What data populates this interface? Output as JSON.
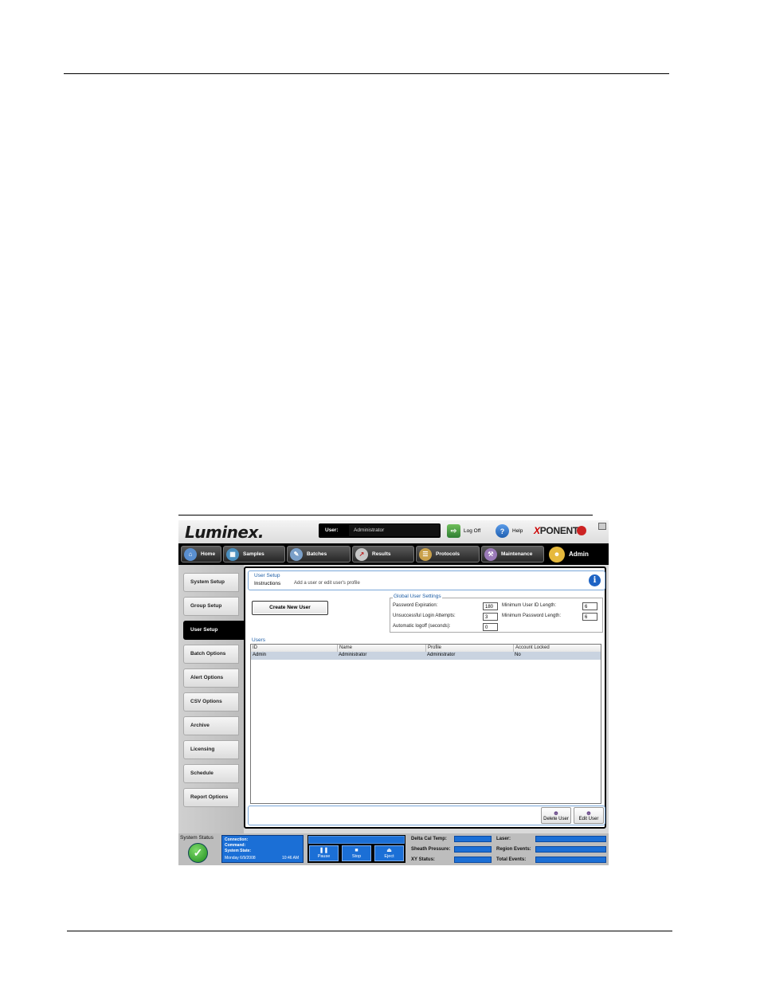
{
  "app": {
    "logo": "Luminex.",
    "user_label": "User:",
    "user_value": "Administrator",
    "logoff_label": "Log Off",
    "help_label": "Help",
    "brand": {
      "x": "X",
      "rest": "PONENT"
    }
  },
  "tabs": [
    {
      "label": "Home",
      "icon": "home-icon"
    },
    {
      "label": "Samples",
      "icon": "samples-icon"
    },
    {
      "label": "Batches",
      "icon": "batches-icon"
    },
    {
      "label": "Results",
      "icon": "results-icon"
    },
    {
      "label": "Protocols",
      "icon": "protocols-icon"
    },
    {
      "label": "Maintenance",
      "icon": "maintenance-icon"
    },
    {
      "label": "Admin",
      "icon": "admin-icon",
      "active": true
    }
  ],
  "sidebar": {
    "items": [
      {
        "label": "System Setup"
      },
      {
        "label": "Group Setup"
      },
      {
        "label": "User Setup",
        "active": true
      },
      {
        "label": "Batch Options"
      },
      {
        "label": "Alert Options"
      },
      {
        "label": "CSV Options"
      },
      {
        "label": "Archive"
      },
      {
        "label": "Licensing"
      },
      {
        "label": "Schedule"
      },
      {
        "label": "Report Options"
      }
    ]
  },
  "header": {
    "title": "User Setup",
    "instructions_label": "Instructions",
    "instructions_text": "Add a user or edit user's profile"
  },
  "create_button": "Create New User",
  "global_settings": {
    "legend": "Global User Settings",
    "password_expiration_label": "Password Expiration:",
    "password_expiration_value": "180",
    "login_attempts_label": "Unsuccessful Login Attempts:",
    "login_attempts_value": "3",
    "auto_logoff_label": "Automatic logoff (seconds):",
    "auto_logoff_value": "0",
    "min_user_id_label": "Minimum User ID Length:",
    "min_user_id_value": "6",
    "min_password_label": "Minimum Password Length:",
    "min_password_value": "6"
  },
  "users": {
    "legend": "Users",
    "columns": [
      "ID",
      "Name",
      "Profile",
      "Account Locked"
    ],
    "rows": [
      [
        "Admin",
        "Administrator",
        "Administrator",
        "No"
      ]
    ]
  },
  "actions": {
    "delete_label": "Delete User",
    "edit_label": "Edit User"
  },
  "status_bar": {
    "system_status_label": "System Status",
    "connection_label": "Connection:",
    "command_label": "Command:",
    "system_state_label": "System State:",
    "date": "Monday 6/9/2008",
    "time": "10:46 AM",
    "pause_label": "Pause",
    "stop_label": "Stop",
    "eject_label": "Eject",
    "delta_cal_temp_label": "Delta Cal Temp:",
    "sheath_pressure_label": "Sheath Pressure:",
    "xy_status_label": "XY Status:",
    "laser_label": "Laser:",
    "region_events_label": "Region Events:",
    "total_events_label": "Total Events:"
  },
  "colors": {
    "accent_blue": "#1b6fd6",
    "header_blue": "#1f5fa6",
    "status_green": "#1e8a1e"
  }
}
